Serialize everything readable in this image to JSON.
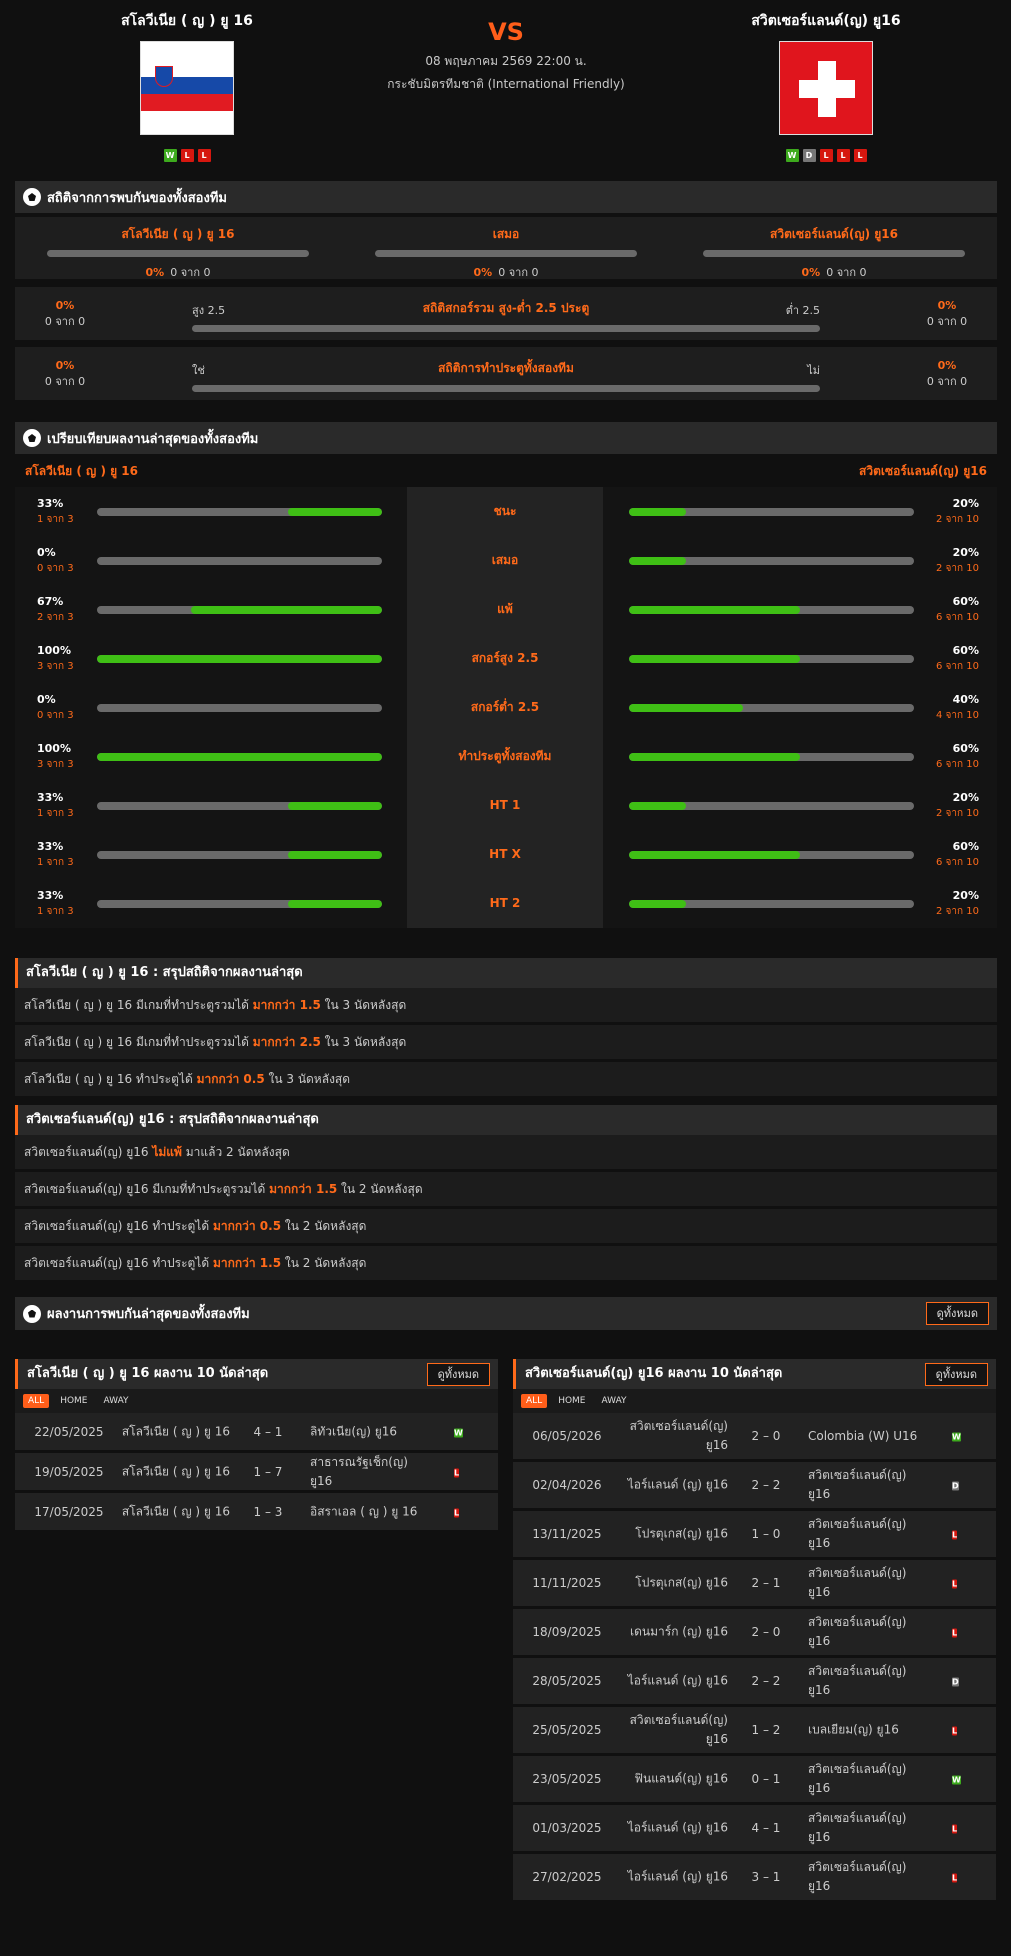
{
  "header": {
    "home": {
      "name": "สโลวีเนีย ( ญ ) ยู 16",
      "form": [
        "W",
        "L",
        "L"
      ]
    },
    "away": {
      "name": "สวิตเซอร์แลนด์(ญ) ยู16",
      "form": [
        "W",
        "D",
        "L",
        "L",
        "L"
      ]
    },
    "vs": "VS",
    "datetime": "08 พฤษภาคม 2569 22:00 น.",
    "competition": "กระชับมิตรทีมชาติ (International Friendly)"
  },
  "h2h": {
    "title": "สถิติจากการพบกันของทั้งสองทีม",
    "cols": [
      {
        "name": "สโลวีเนีย ( ญ ) ยู 16",
        "pct": "0%",
        "count": "0 จาก 0"
      },
      {
        "name": "เสมอ",
        "pct": "0%",
        "count": "0 จาก 0"
      },
      {
        "name": "สวิตเซอร์แลนด์(ญ) ยู16",
        "pct": "0%",
        "count": "0 จาก 0"
      }
    ],
    "ou": {
      "title": "สถิติสกอร์รวม สูง-ต่ำ 2.5 ประตู",
      "left_label": "สูง 2.5",
      "right_label": "ต่ำ 2.5",
      "left_pct": "0%",
      "left_count": "0 จาก 0",
      "right_pct": "0%",
      "right_count": "0 จาก 0"
    },
    "btts": {
      "title": "สถิติการทำประตูทั้งสองทีม",
      "left_label": "ใช่",
      "right_label": "ไม่",
      "left_pct": "0%",
      "left_count": "0 จาก 0",
      "right_pct": "0%",
      "right_count": "0 จาก 0"
    }
  },
  "compare": {
    "title": "เปรียบเทียบผลงานล่าสุดของทั้งสองทีม",
    "home_name": "สโลวีเนีย ( ญ ) ยู 16",
    "away_name": "สวิตเซอร์แลนด์(ญ) ยู16",
    "rows": [
      {
        "label": "ชนะ",
        "hp": "33%",
        "hc": "1 จาก 3",
        "hv": 0.33,
        "ap": "20%",
        "ac": "2 จาก 10",
        "av": 0.2
      },
      {
        "label": "เสมอ",
        "hp": "0%",
        "hc": "0 จาก 3",
        "hv": 0,
        "ap": "20%",
        "ac": "2 จาก 10",
        "av": 0.2
      },
      {
        "label": "แพ้",
        "hp": "67%",
        "hc": "2 จาก 3",
        "hv": 0.67,
        "ap": "60%",
        "ac": "6 จาก 10",
        "av": 0.6
      },
      {
        "label": "สกอร์สูง 2.5",
        "hp": "100%",
        "hc": "3 จาก 3",
        "hv": 1.0,
        "ap": "60%",
        "ac": "6 จาก 10",
        "av": 0.6
      },
      {
        "label": "สกอร์ต่ำ 2.5",
        "hp": "0%",
        "hc": "0 จาก 3",
        "hv": 0,
        "ap": "40%",
        "ac": "4 จาก 10",
        "av": 0.4
      },
      {
        "label": "ทำประตูทั้งสองทีม",
        "hp": "100%",
        "hc": "3 จาก 3",
        "hv": 1.0,
        "ap": "60%",
        "ac": "6 จาก 10",
        "av": 0.6
      },
      {
        "label": "HT 1",
        "hp": "33%",
        "hc": "1 จาก 3",
        "hv": 0.33,
        "ap": "20%",
        "ac": "2 จาก 10",
        "av": 0.2
      },
      {
        "label": "HT X",
        "hp": "33%",
        "hc": "1 จาก 3",
        "hv": 0.33,
        "ap": "60%",
        "ac": "6 จาก 10",
        "av": 0.6
      },
      {
        "label": "HT 2",
        "hp": "33%",
        "hc": "1 จาก 3",
        "hv": 0.33,
        "ap": "20%",
        "ac": "2 จาก 10",
        "av": 0.2
      }
    ]
  },
  "home_summary": {
    "title": "สโลวีเนีย ( ญ ) ยู 16 : สรุปสถิติจากผลงานล่าสุด",
    "rows": [
      {
        "pre": "สโลวีเนีย ( ญ ) ยู 16  มีเกมที่ทำประตูรวมได้ ",
        "hl": "มากกว่า  1.5",
        "post": "  ใน 3 นัดหลังสุด"
      },
      {
        "pre": "สโลวีเนีย ( ญ ) ยู 16  มีเกมที่ทำประตูรวมได้ ",
        "hl": "มากกว่า  2.5",
        "post": "  ใน 3 นัดหลังสุด"
      },
      {
        "pre": "สโลวีเนีย ( ญ ) ยู 16  ทำประตูได้ ",
        "hl": "มากกว่า  0.5",
        "post": "  ใน 3 นัดหลังสุด"
      }
    ]
  },
  "away_summary": {
    "title": "สวิตเซอร์แลนด์(ญ) ยู16 : สรุปสถิติจากผลงานล่าสุด",
    "rows": [
      {
        "pre": "สวิตเซอร์แลนด์(ญ) ยู16  ",
        "hl": "ไม่แพ้",
        "post": "  มาแล้ว 2 นัดหลังสุด"
      },
      {
        "pre": "สวิตเซอร์แลนด์(ญ) ยู16  มีเกมที่ทำประตูรวมได้ ",
        "hl": "มากกว่า  1.5",
        "post": "  ใน 2 นัดหลังสุด"
      },
      {
        "pre": "สวิตเซอร์แลนด์(ญ) ยู16  ทำประตูได้ ",
        "hl": "มากกว่า  0.5",
        "post": "  ใน 2 นัดหลังสุด"
      },
      {
        "pre": "สวิตเซอร์แลนด์(ญ) ยู16  ทำประตูได้ ",
        "hl": "มากกว่า  1.5",
        "post": "  ใน 2 นัดหลังสุด"
      }
    ]
  },
  "recent_h2h": {
    "title": "ผลงานการพบกันล่าสุดของทั้งสองทีม",
    "view_all": "ดูทั้งหมด"
  },
  "home_last10": {
    "title": "สโลวีเนีย ( ญ ) ยู 16 ผลงาน 10 นัดล่าสุด",
    "view_all": "ดูทั้งหมด",
    "tabs": [
      "ALL",
      "HOME",
      "AWAY"
    ],
    "matches": [
      {
        "date": "22/05/2025",
        "home": "สโลวีเนีย ( ญ ) ยู 16",
        "score": "4 – 1",
        "away": "ลิทัวเนีย(ญ) ยู16",
        "res": "W"
      },
      {
        "date": "19/05/2025",
        "home": "สโลวีเนีย ( ญ ) ยู 16",
        "score": "1 – 7",
        "away": "สาธารณรัฐเช็ก(ญ) ยู16",
        "res": "L"
      },
      {
        "date": "17/05/2025",
        "home": "สโลวีเนีย ( ญ ) ยู 16",
        "score": "1 – 3",
        "away": "อิสราเอล ( ญ ) ยู 16",
        "res": "L"
      }
    ]
  },
  "away_last10": {
    "title": "สวิตเซอร์แลนด์(ญ) ยู16 ผลงาน 10 นัดล่าสุด",
    "view_all": "ดูทั้งหมด",
    "tabs": [
      "ALL",
      "HOME",
      "AWAY"
    ],
    "matches": [
      {
        "date": "06/05/2026",
        "home": "สวิตเซอร์แลนด์(ญ) ยู16",
        "score": "2 – 0",
        "away": "Colombia (W) U16",
        "res": "W"
      },
      {
        "date": "02/04/2026",
        "home": "ไอร์แลนด์ (ญ) ยู16",
        "score": "2 – 2",
        "away": "สวิตเซอร์แลนด์(ญ) ยู16",
        "res": "D"
      },
      {
        "date": "13/11/2025",
        "home": "โปรตุเกส(ญ) ยู16",
        "score": "1 – 0",
        "away": "สวิตเซอร์แลนด์(ญ) ยู16",
        "res": "L"
      },
      {
        "date": "11/11/2025",
        "home": "โปรตุเกส(ญ) ยู16",
        "score": "2 – 1",
        "away": "สวิตเซอร์แลนด์(ญ) ยู16",
        "res": "L"
      },
      {
        "date": "18/09/2025",
        "home": "เดนมาร์ก (ญ) ยู16",
        "score": "2 – 0",
        "away": "สวิตเซอร์แลนด์(ญ) ยู16",
        "res": "L"
      },
      {
        "date": "28/05/2025",
        "home": "ไอร์แลนด์ (ญ) ยู16",
        "score": "2 – 2",
        "away": "สวิตเซอร์แลนด์(ญ) ยู16",
        "res": "D"
      },
      {
        "date": "25/05/2025",
        "home": "สวิตเซอร์แลนด์(ญ) ยู16",
        "score": "1 – 2",
        "away": "เบลเยียม(ญ) ยู16",
        "res": "L"
      },
      {
        "date": "23/05/2025",
        "home": "ฟินแลนด์(ญ) ยู16",
        "score": "0 – 1",
        "away": "สวิตเซอร์แลนด์(ญ) ยู16",
        "res": "W"
      },
      {
        "date": "01/03/2025",
        "home": "ไอร์แลนด์ (ญ) ยู16",
        "score": "4 – 1",
        "away": "สวิตเซอร์แลนด์(ญ) ยู16",
        "res": "L"
      },
      {
        "date": "27/02/2025",
        "home": "ไอร์แลนด์ (ญ) ยู16",
        "score": "3 – 1",
        "away": "สวิตเซอร์แลนด์(ญ) ยู16",
        "res": "L"
      }
    ]
  }
}
